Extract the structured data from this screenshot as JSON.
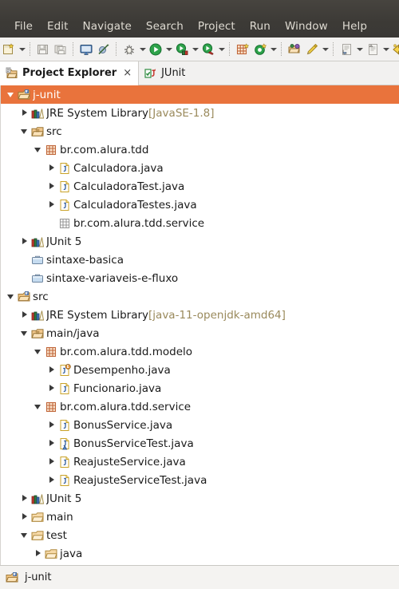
{
  "menubar": {
    "items": [
      {
        "label": "File",
        "name": "menu-file"
      },
      {
        "label": "Edit",
        "name": "menu-edit"
      },
      {
        "label": "Navigate",
        "name": "menu-navigate"
      },
      {
        "label": "Search",
        "name": "menu-search"
      },
      {
        "label": "Project",
        "name": "menu-project"
      },
      {
        "label": "Run",
        "name": "menu-run"
      },
      {
        "label": "Window",
        "name": "menu-window"
      },
      {
        "label": "Help",
        "name": "menu-help"
      }
    ]
  },
  "toolbar": {
    "buttons": [
      {
        "name": "new-wizard-icon",
        "icon": "new",
        "dropdown": true
      },
      {
        "name": "separator",
        "icon": "sep"
      },
      {
        "name": "save-icon",
        "icon": "save",
        "dropdown": false
      },
      {
        "name": "save-all-icon",
        "icon": "saveall",
        "dropdown": false
      },
      {
        "name": "separator",
        "icon": "sep"
      },
      {
        "name": "open-console-icon",
        "icon": "console",
        "dropdown": false
      },
      {
        "name": "skip-breakpoints-icon",
        "icon": "skipbp",
        "dropdown": false
      },
      {
        "name": "separator",
        "icon": "sep"
      },
      {
        "name": "debug-icon",
        "icon": "debug",
        "dropdown": true
      },
      {
        "name": "run-icon",
        "icon": "run",
        "dropdown": true
      },
      {
        "name": "coverage-icon",
        "icon": "coverage",
        "dropdown": true
      },
      {
        "name": "run-external-tools-icon",
        "icon": "exttools",
        "dropdown": true
      },
      {
        "name": "separator",
        "icon": "sep"
      },
      {
        "name": "new-java-package-icon",
        "icon": "newpkg",
        "dropdown": false
      },
      {
        "name": "new-java-class-icon",
        "icon": "newclass",
        "dropdown": true
      },
      {
        "name": "separator",
        "icon": "sep"
      },
      {
        "name": "open-type-icon",
        "icon": "opentype",
        "dropdown": false
      },
      {
        "name": "search-icon",
        "icon": "searchpen",
        "dropdown": true
      },
      {
        "name": "separator",
        "icon": "sep"
      },
      {
        "name": "next-annotation-icon",
        "icon": "nextannot",
        "dropdown": true
      },
      {
        "name": "previous-annotation-icon",
        "icon": "prevannot",
        "dropdown": true
      },
      {
        "name": "back-icon",
        "icon": "back",
        "dropdown": false
      },
      {
        "name": "forward-icon",
        "icon": "forward",
        "dropdown": false
      }
    ]
  },
  "tabs": [
    {
      "label": "Project Explorer",
      "name": "tab-project-explorer",
      "active": true,
      "icon": "project-explorer-icon",
      "closable": true,
      "close_label": "×"
    },
    {
      "label": "JUnit",
      "name": "tab-junit",
      "active": false,
      "icon": "junit-icon",
      "closable": false
    }
  ],
  "tree": {
    "rows": [
      {
        "name": "tree-item-j-unit",
        "label": "j-unit",
        "suffix": "",
        "indent": 0,
        "twisty": "open",
        "icon": "java-project",
        "selected": true
      },
      {
        "name": "tree-item-jre-system-library",
        "label": "JRE System Library ",
        "suffix": "[JavaSE-1.8]",
        "indent": 1,
        "twisty": "closed",
        "icon": "library",
        "selected": false
      },
      {
        "name": "tree-item-src",
        "label": "src",
        "suffix": "",
        "indent": 1,
        "twisty": "open",
        "icon": "source-folder",
        "selected": false
      },
      {
        "name": "tree-item-br-com-alura-tdd",
        "label": "br.com.alura.tdd",
        "suffix": "",
        "indent": 2,
        "twisty": "open",
        "icon": "package",
        "selected": false
      },
      {
        "name": "tree-item-calculadora-java",
        "label": "Calculadora.java",
        "suffix": "",
        "indent": 3,
        "twisty": "closed",
        "icon": "java-file",
        "selected": false
      },
      {
        "name": "tree-item-calculadoratest-java",
        "label": "CalculadoraTest.java",
        "suffix": "",
        "indent": 3,
        "twisty": "closed",
        "icon": "java-file",
        "selected": false
      },
      {
        "name": "tree-item-calculadoratestes-java",
        "label": "CalculadoraTestes.java",
        "suffix": "",
        "indent": 3,
        "twisty": "closed",
        "icon": "java-file",
        "selected": false
      },
      {
        "name": "tree-item-br-com-alura-tdd-service",
        "label": "br.com.alura.tdd.service",
        "suffix": "",
        "indent": 3,
        "twisty": "none",
        "icon": "package-empty",
        "selected": false
      },
      {
        "name": "tree-item-junit-5-a",
        "label": "JUnit 5",
        "suffix": "",
        "indent": 1,
        "twisty": "closed",
        "icon": "library",
        "selected": false
      },
      {
        "name": "tree-item-sintaxe-basica",
        "label": "sintaxe-basica",
        "suffix": "",
        "indent": 1,
        "twisty": "none",
        "icon": "closed-project",
        "selected": false
      },
      {
        "name": "tree-item-sintaxe-variaveis-e-fluxo",
        "label": "sintaxe-variaveis-e-fluxo",
        "suffix": "",
        "indent": 1,
        "twisty": "none",
        "icon": "closed-project",
        "selected": false
      },
      {
        "name": "tree-item-src-root",
        "label": "src",
        "suffix": "",
        "indent": 0,
        "twisty": "open",
        "icon": "java-project",
        "selected": false
      },
      {
        "name": "tree-item-jre-system-library-2",
        "label": "JRE System Library ",
        "suffix": "[java-11-openjdk-amd64]",
        "indent": 1,
        "twisty": "closed",
        "icon": "library",
        "selected": false
      },
      {
        "name": "tree-item-main-java",
        "label": "main/java",
        "suffix": "",
        "indent": 1,
        "twisty": "open",
        "icon": "source-folder",
        "selected": false
      },
      {
        "name": "tree-item-br-com-alura-tdd-modelo",
        "label": "br.com.alura.tdd.modelo",
        "suffix": "",
        "indent": 2,
        "twisty": "open",
        "icon": "package",
        "selected": false
      },
      {
        "name": "tree-item-desempenho-java",
        "label": "Desempenho.java",
        "suffix": "",
        "indent": 3,
        "twisty": "closed",
        "icon": "java-enum-file",
        "selected": false
      },
      {
        "name": "tree-item-funcionario-java",
        "label": "Funcionario.java",
        "suffix": "",
        "indent": 3,
        "twisty": "closed",
        "icon": "java-file",
        "selected": false
      },
      {
        "name": "tree-item-br-com-alura-tdd-service-2",
        "label": "br.com.alura.tdd.service",
        "suffix": "",
        "indent": 2,
        "twisty": "open",
        "icon": "package",
        "selected": false
      },
      {
        "name": "tree-item-bonusservice-java",
        "label": "BonusService.java",
        "suffix": "",
        "indent": 3,
        "twisty": "closed",
        "icon": "java-file",
        "selected": false
      },
      {
        "name": "tree-item-bonusservicetest-java",
        "label": "BonusServiceTest.java",
        "suffix": "",
        "indent": 3,
        "twisty": "closed",
        "icon": "java-test-file",
        "selected": false
      },
      {
        "name": "tree-item-reajusteservice-java",
        "label": "ReajusteService.java",
        "suffix": "",
        "indent": 3,
        "twisty": "closed",
        "icon": "java-file",
        "selected": false
      },
      {
        "name": "tree-item-reajusteservicetest-java",
        "label": "ReajusteServiceTest.java",
        "suffix": "",
        "indent": 3,
        "twisty": "closed",
        "icon": "java-file",
        "selected": false
      },
      {
        "name": "tree-item-junit-5-b",
        "label": "JUnit 5",
        "suffix": "",
        "indent": 1,
        "twisty": "closed",
        "icon": "library",
        "selected": false
      },
      {
        "name": "tree-item-main",
        "label": "main",
        "suffix": "",
        "indent": 1,
        "twisty": "closed",
        "icon": "folder",
        "selected": false
      },
      {
        "name": "tree-item-test",
        "label": "test",
        "suffix": "",
        "indent": 1,
        "twisty": "open",
        "icon": "folder",
        "selected": false
      },
      {
        "name": "tree-item-java",
        "label": "java",
        "suffix": "",
        "indent": 2,
        "twisty": "closed",
        "icon": "folder",
        "selected": false
      }
    ]
  },
  "statusbar": {
    "label": "j-unit",
    "icon": "java-project-icon"
  },
  "colors": {
    "selection": "#E9733C",
    "menubar": "#3C3A36",
    "toolbar": "#F2F1F0",
    "library_suffix": "#9A8A5C"
  }
}
